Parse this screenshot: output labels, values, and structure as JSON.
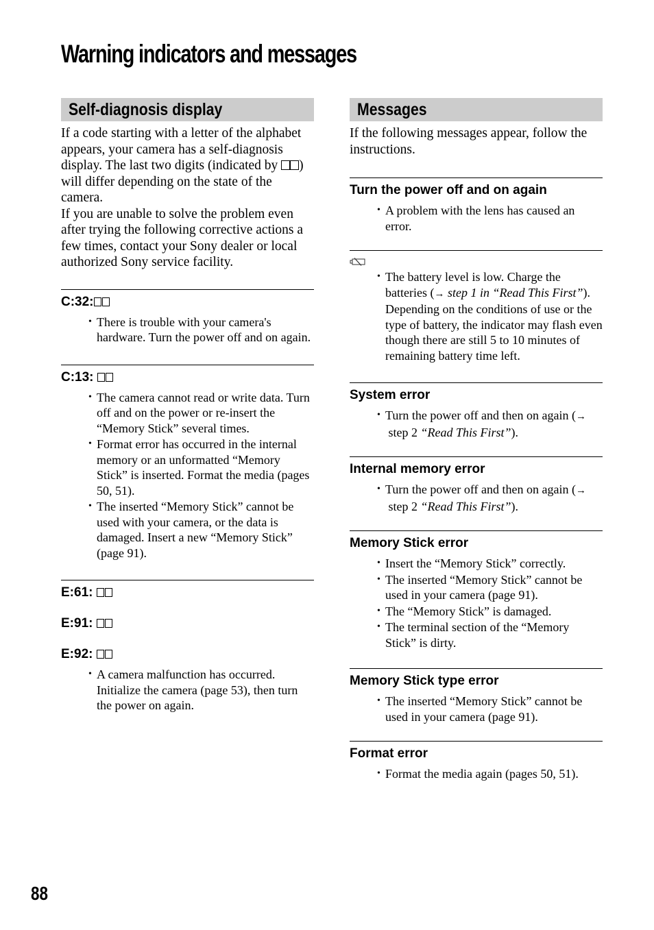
{
  "page": {
    "title": "Warning indicators and messages",
    "page_number": "88"
  },
  "left_column": {
    "section_title": "Self-diagnosis display",
    "intro_part1": "If a code starting with a letter of the alphabet appears, your camera has a self-diagnosis display. The last two digits (indicated by ",
    "intro_part2": ") will differ depending on the state of the camera.",
    "intro_part3": "If you are unable to solve the problem even after trying the following corrective actions a few times, contact your Sony dealer or local authorized Sony service facility.",
    "entries": [
      {
        "codes": [
          "C:32:"
        ],
        "bullets": [
          "There is trouble with your camera's hardware. Turn the power off and on again."
        ]
      },
      {
        "codes": [
          "C:13: "
        ],
        "bullets": [
          "The camera cannot read or write data. Turn off and on the power or re-insert the “Memory Stick” several times.",
          "Format error has occurred in the internal memory or an unformatted “Memory Stick” is inserted. Format the media (pages 50, 51).",
          "The inserted “Memory Stick” cannot be used with your camera, or the data is damaged. Insert a new “Memory Stick” (page 91)."
        ]
      },
      {
        "codes": [
          "E:61: ",
          "E:91: ",
          "E:92: "
        ],
        "bullets": [
          "A camera malfunction has occurred. Initialize the camera (page 53), then turn the power on again."
        ]
      }
    ]
  },
  "right_column": {
    "section_title": "Messages",
    "intro": "If the following messages appear, follow the instructions.",
    "entries": [
      {
        "heading": "Turn the power off and on again",
        "bullets": [
          "A problem with the lens has caused an error."
        ]
      },
      {
        "heading_icon": "battery-low-icon",
        "battery_bullet": {
          "text1": "The battery level is low. Charge the batteries (",
          "arrow": "→",
          "italic": " step 1 in “Read This First”",
          "text2": "). Depending on the conditions of use or the type of battery, the indicator may flash even though there are still 5 to 10 minutes of remaining battery time left."
        }
      },
      {
        "heading": "System error",
        "ref": {
          "text1": "Turn the power off and then on again (",
          "arrow": "→",
          "text2": " step 2 ",
          "italic": "“Read This First”",
          "text3": ")."
        }
      },
      {
        "heading": "Internal memory error",
        "ref": {
          "text1": "Turn the power off and then on again (",
          "arrow": "→",
          "text2": " step 2 ",
          "italic": "“Read This First”",
          "text3": ")."
        }
      },
      {
        "heading": "Memory Stick error",
        "bullets": [
          "Insert the “Memory Stick” correctly.",
          "The inserted “Memory Stick” cannot be used in your camera (page 91).",
          "The “Memory Stick” is damaged.",
          "The terminal section of the “Memory Stick” is dirty."
        ]
      },
      {
        "heading": "Memory Stick type error",
        "bullets": [
          "The inserted “Memory Stick” cannot be used in your camera (page 91)."
        ]
      },
      {
        "heading": "Format error",
        "bullets": [
          "Format the media again (pages 50, 51)."
        ]
      }
    ]
  }
}
